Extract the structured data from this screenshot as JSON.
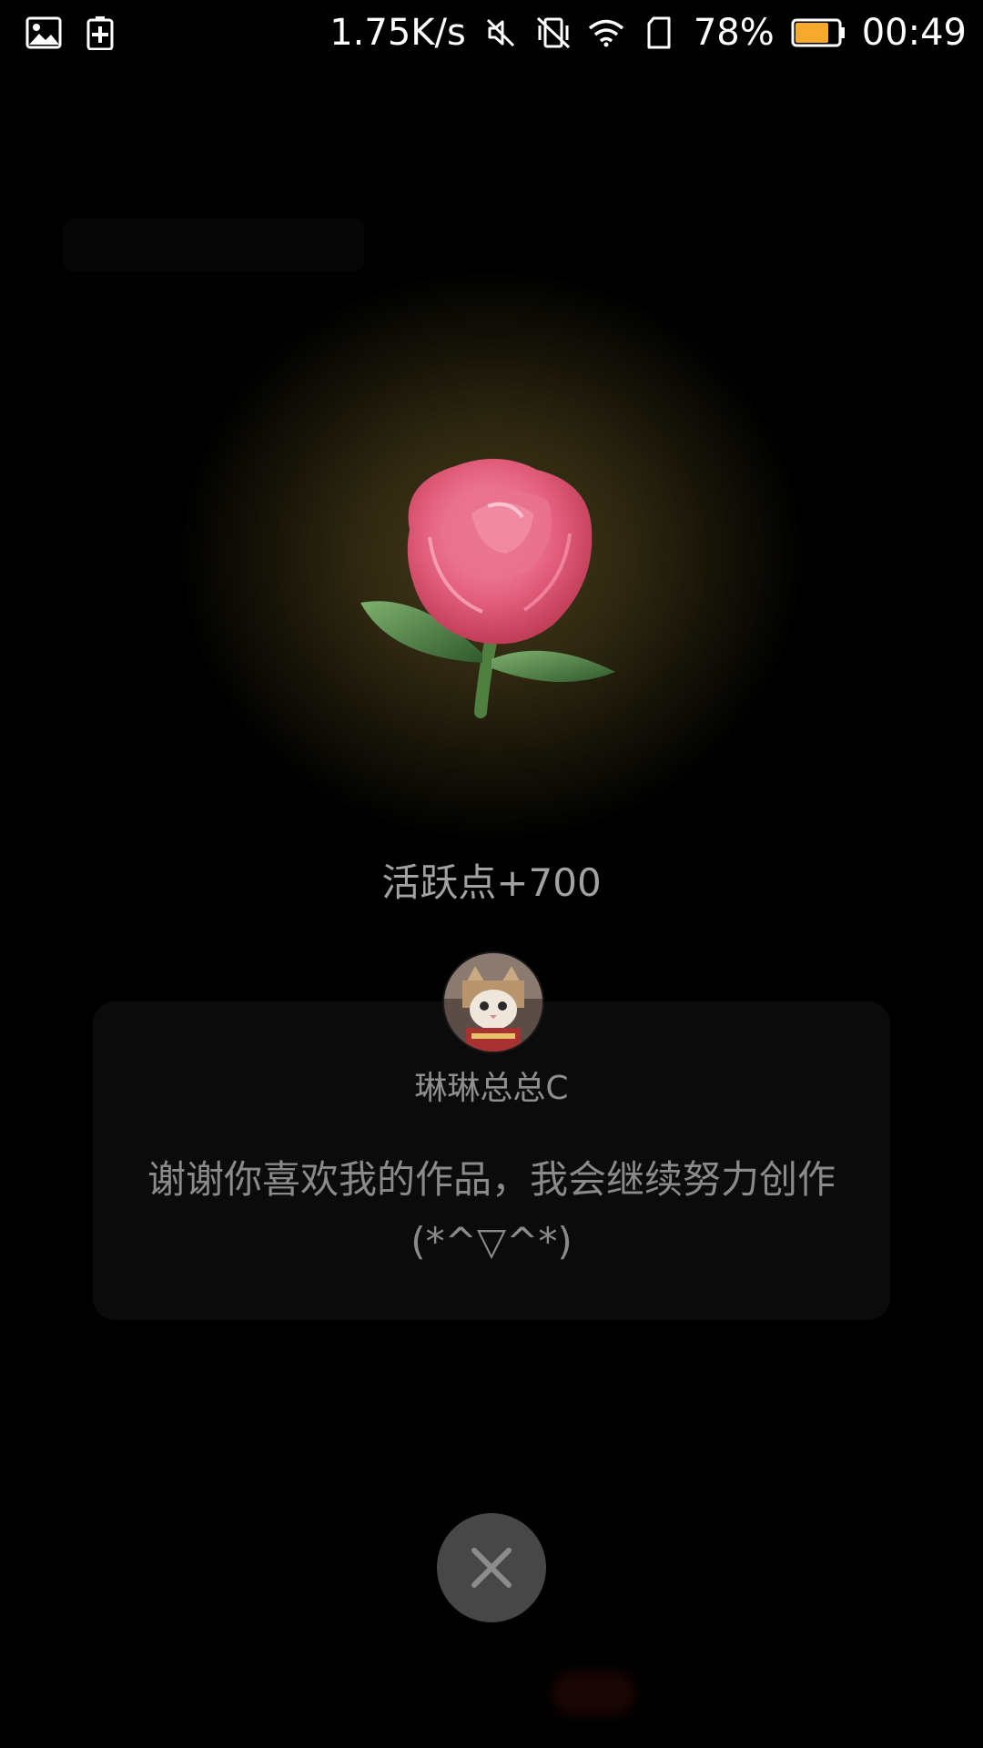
{
  "status_bar": {
    "network_speed": "1.75K/s",
    "battery_percent": "78%",
    "battery_level": 0.78,
    "time": "00:49",
    "icons": [
      "gallery-icon",
      "battery-saver-icon",
      "mute-icon",
      "vibrate-off-icon",
      "wifi-icon",
      "sim-icon",
      "battery-icon"
    ]
  },
  "gift": {
    "icon": "rose-icon",
    "points_text": "活跃点+700"
  },
  "card": {
    "username": "琳琳总总C",
    "message": "谢谢你喜欢我的作品，我会继续努力创作(*^▽^*)",
    "avatar_icon": "cat-avatar"
  },
  "close": {
    "icon": "close-icon"
  },
  "colors": {
    "background": "#000000",
    "glow": "#463c1c",
    "rose": "#e86a8a",
    "battery": "#f6a92a",
    "close_button": "#474747"
  }
}
